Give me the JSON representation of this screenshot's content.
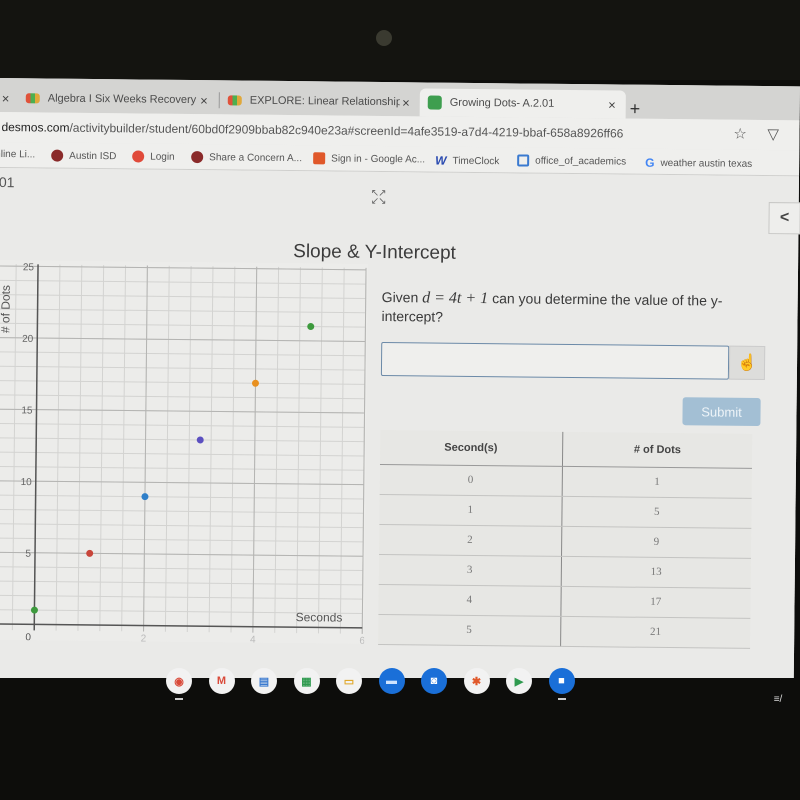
{
  "browser": {
    "tabs": [
      {
        "title": "Algebra I Six Weeks Recovery M",
        "close": "×",
        "active": false
      },
      {
        "title": "EXPLORE: Linear Relationships",
        "close": "×",
        "active": false
      },
      {
        "title": "Growing Dots- A.2.01",
        "close": "×",
        "active": true
      }
    ],
    "new_tab": "+",
    "url_domain": "desmos.com",
    "url_path": "/activitybuilder/student/60bd0f2909bbab82c940e23a#screenId=4afe3519-a7d4-4219-bbaf-658a8926ff66",
    "bookmarks": [
      {
        "label": "nline Li...",
        "icon_color": ""
      },
      {
        "label": "Austin ISD",
        "icon_color": "#8a2a2a"
      },
      {
        "label": "Login",
        "icon_color": "#e04a3a"
      },
      {
        "label": "Share a Concern A...",
        "icon_color": "#8a2a2a"
      },
      {
        "label": "Sign in - Google Ac...",
        "icon_color": "#e0582a"
      },
      {
        "label": "TimeClock",
        "icon_color": "#2a4ab0"
      },
      {
        "label": "office_of_academics",
        "icon_color": "#3a7ad0"
      },
      {
        "label": "weather austin texas",
        "icon_color": "#4285f4"
      }
    ],
    "star_icon": "☆",
    "extension_icon": "▽"
  },
  "page": {
    "screen_code": "01",
    "title": "Slope & Y-Intercept",
    "back_label": "<",
    "question_pre": "Given ",
    "question_math": "d = 4t + 1",
    "question_post": " can you determine the value of the y-intercept?",
    "answer_value": "",
    "submit_label": "Submit",
    "table": {
      "headers": [
        "Second(s)",
        "# of Dots"
      ],
      "rows": [
        [
          "0",
          "1"
        ],
        [
          "1",
          "5"
        ],
        [
          "2",
          "9"
        ],
        [
          "3",
          "13"
        ],
        [
          "4",
          "17"
        ],
        [
          "5",
          "21"
        ]
      ]
    }
  },
  "chart_data": {
    "type": "scatter",
    "title": "",
    "xlabel": "Seconds",
    "ylabel": "# of Dots",
    "xlim": [
      -0.5,
      6
    ],
    "ylim": [
      -0.5,
      25
    ],
    "x_ticks": [
      0,
      2,
      4,
      6
    ],
    "y_ticks": [
      5,
      10,
      15,
      20,
      25
    ],
    "grid": true,
    "points": [
      {
        "x": 0,
        "y": 1,
        "color": "#3d9a3d"
      },
      {
        "x": 1,
        "y": 5,
        "color": "#c8453a"
      },
      {
        "x": 2,
        "y": 9,
        "color": "#2f7fc9"
      },
      {
        "x": 3,
        "y": 13,
        "color": "#5b4fc0"
      },
      {
        "x": 4,
        "y": 17,
        "color": "#e8901f"
      },
      {
        "x": 5,
        "y": 21,
        "color": "#3d9a3d"
      }
    ]
  },
  "shelf": {
    "apps": [
      {
        "name": "chrome",
        "glyph": "◉",
        "bg": "#f2f2f2",
        "fg": "#d94a3a"
      },
      {
        "name": "gmail",
        "glyph": "M",
        "bg": "#f2f2f2",
        "fg": "#d94a3a"
      },
      {
        "name": "docs",
        "glyph": "▤",
        "bg": "#f2f2f2",
        "fg": "#3a7ad0"
      },
      {
        "name": "sheets",
        "glyph": "▦",
        "bg": "#f2f2f2",
        "fg": "#2f9a4f"
      },
      {
        "name": "slides",
        "glyph": "▭",
        "bg": "#f2f2f2",
        "fg": "#e0a82a"
      },
      {
        "name": "files",
        "glyph": "▬",
        "bg": "#1a6fd8",
        "fg": "#cfe4ff"
      },
      {
        "name": "camera",
        "glyph": "◙",
        "bg": "#1a6fd8",
        "fg": "#ffffff"
      },
      {
        "name": "photos",
        "glyph": "✱",
        "bg": "#f2f2f2",
        "fg": "#e0582a"
      },
      {
        "name": "play-store",
        "glyph": "▶",
        "bg": "#f2f2f2",
        "fg": "#2f9a4f"
      },
      {
        "name": "zoom",
        "glyph": "■",
        "bg": "#1a6fd8",
        "fg": "#ffffff"
      }
    ],
    "tray_label": "≡/"
  }
}
